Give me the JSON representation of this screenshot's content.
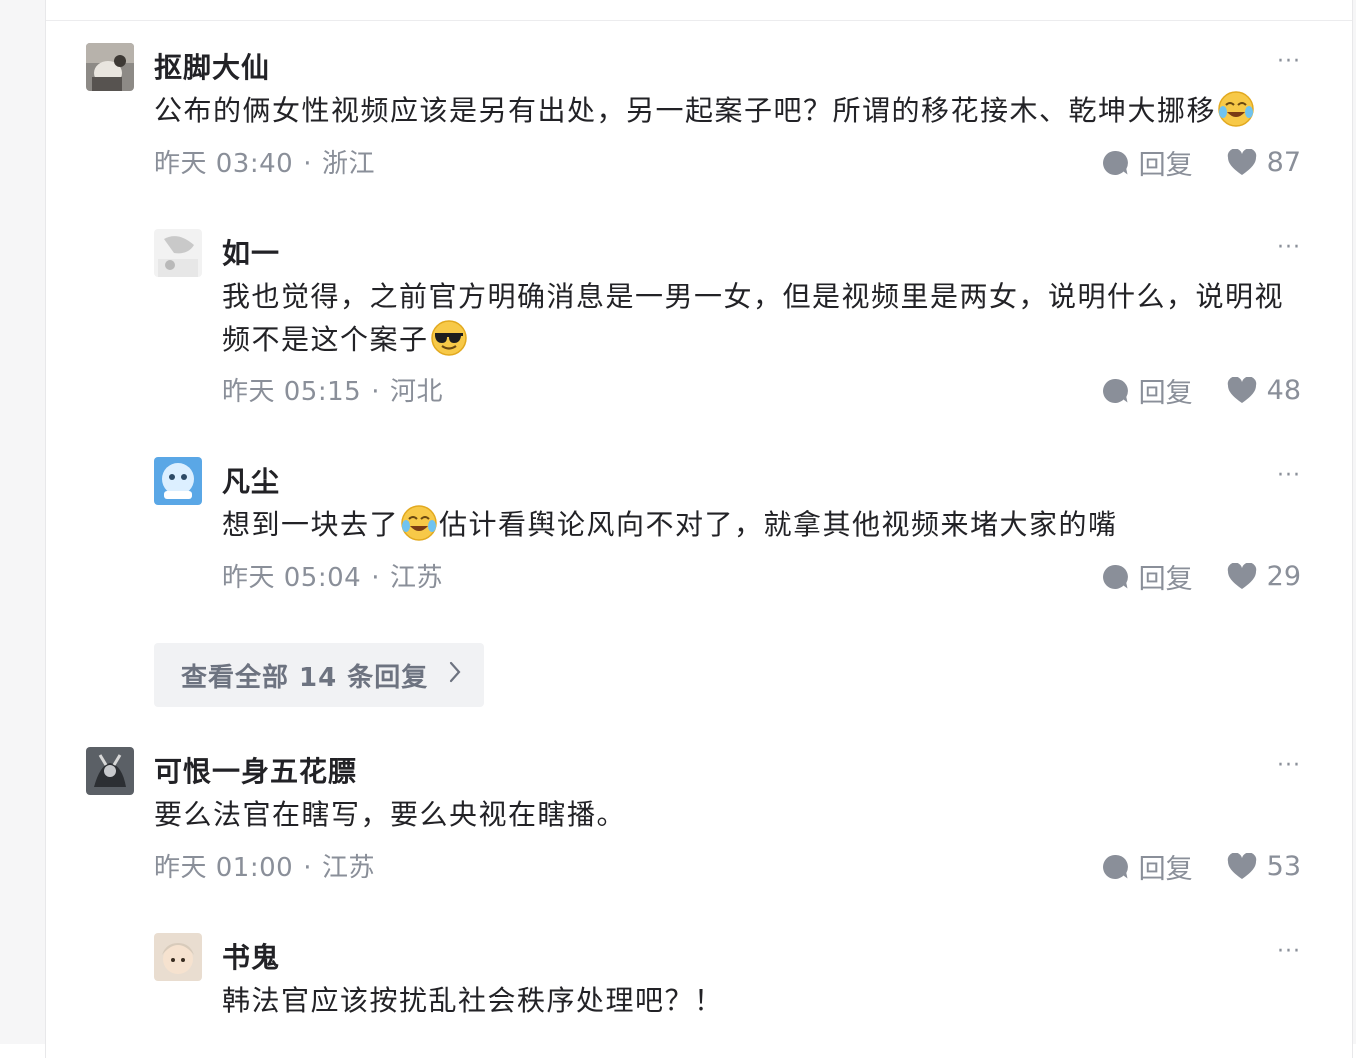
{
  "comments": [
    {
      "author": "抠脚大仙",
      "text": "公布的俩女性视频应该是另有出处，另一起案子吧？所谓的移花接木、乾坤大挪移",
      "emoji": "laugh-cry",
      "time": "昨天 03:40",
      "location": "浙江",
      "reply_label": "回复",
      "likes": "87"
    },
    {
      "author": "如一",
      "text_line1": "我也觉得，之前官方明确消息是一男一女，但是视频里是两女，说明什么，说明视",
      "text_line2": "频不是这个案子",
      "emoji": "sunglasses",
      "time": "昨天 05:15",
      "location": "河北",
      "reply_label": "回复",
      "likes": "48"
    },
    {
      "author": "凡尘",
      "text_before": "想到一块去了",
      "emoji": "laugh-cry",
      "text_after": "估计看舆论风向不对了，就拿其他视频来堵大家的嘴",
      "time": "昨天 05:04",
      "location": "江苏",
      "reply_label": "回复",
      "likes": "29"
    },
    {
      "author": "可恨一身五花膘",
      "text": "要么法官在瞎写，要么央视在瞎播。",
      "time": "昨天 01:00",
      "location": "江苏",
      "reply_label": "回复",
      "likes": "53"
    },
    {
      "author": "书鬼",
      "text": "韩法官应该按扰乱社会秩序处理吧？！",
      "time": "",
      "location": "",
      "reply_label": "",
      "likes": ""
    }
  ],
  "view_all_replies": "查看全部 14 条回复",
  "more_icon_glyph": "···",
  "meta_separator": "·",
  "icons": {
    "reply": "comment-bubble-icon",
    "like": "heart-icon",
    "more": "more-dots-icon",
    "chevron": "chevron-right-icon"
  },
  "colors": {
    "text_primary": "#222226",
    "text_secondary": "#8a8f99",
    "button_bg": "#f1f2f4"
  }
}
